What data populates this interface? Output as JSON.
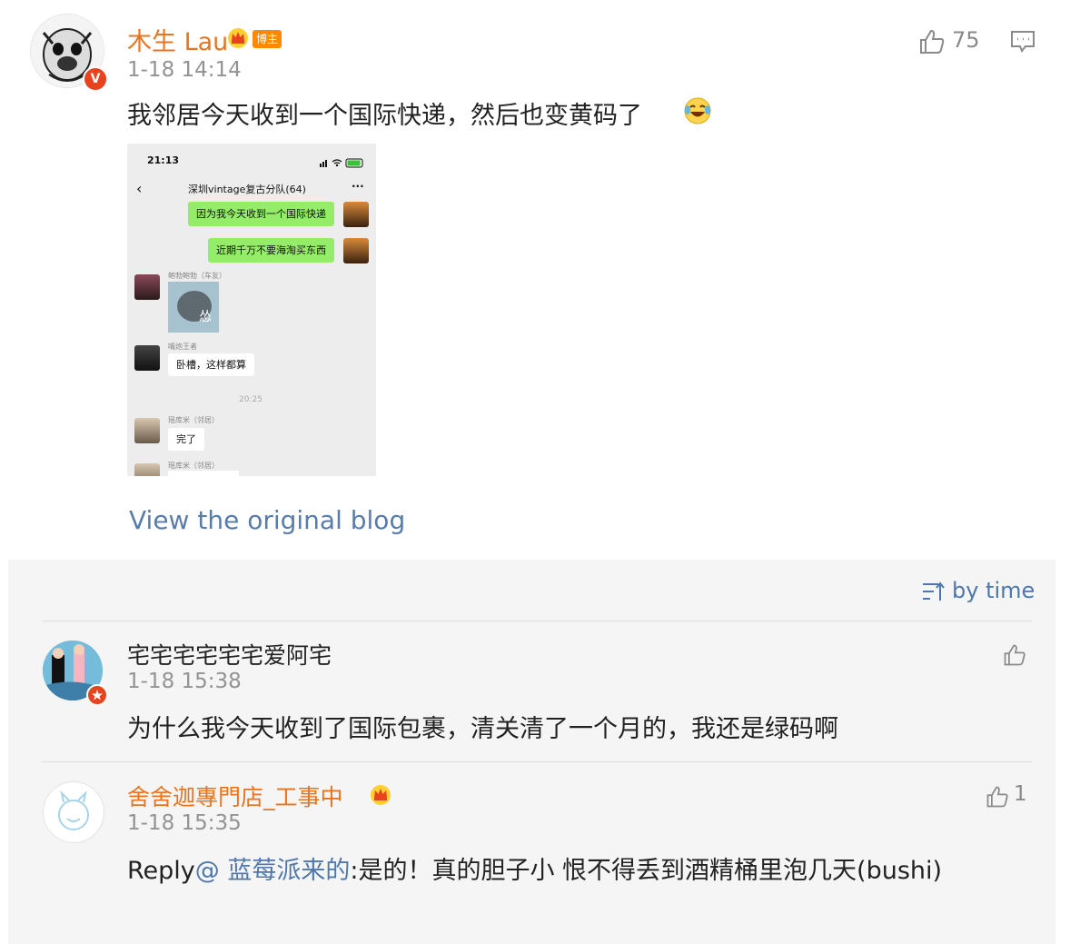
{
  "post": {
    "author": "木生 Lau",
    "host_badge": "博主",
    "verified_badge": "V",
    "time": "1-18 14:14",
    "text": "我邻居今天收到一个国际快递，然后也变黄码了",
    "like_count": "75",
    "view_original": "View the original blog"
  },
  "screenshot": {
    "status_time": "21:13",
    "chat_title": "深圳vintage复古分队(64)",
    "more": "···",
    "messages": [
      "因为我今天收到一个国际快递",
      "近期千万不要海淘买东西"
    ],
    "sender1": "鲍勃鲍勃（车友）",
    "sticker_char": "怂",
    "sender2": "嘴炮王者",
    "reply2": "卧槽，这样都算",
    "divider_time": "20:25",
    "sender3": "瑶库米（邻居）",
    "reply3": "完了",
    "sender4": "瑶库米（邻居）"
  },
  "comments_header": {
    "sort_label": "by time"
  },
  "comments": [
    {
      "name": "宅宅宅宅宅宅爱阿宅",
      "time": "1-18 15:38",
      "text": "为什么我今天收到了国际包裹，清关清了一个月的，我还是绿码啊"
    },
    {
      "name": "舍舍迦專門店_工事中",
      "time": "1-18 15:35",
      "like_count": "1",
      "reply_prefix": "Reply",
      "mention": "@ 蓝莓派来的",
      "text": ":是的！真的胆子小 恨不得丢到酒精桶里泡几天(bushi)"
    }
  ],
  "colors": {
    "orange_name": "#e8741f",
    "link_blue": "#5a7ca8",
    "sort_blue": "#4f77ab",
    "wechat_green": "#95ec69",
    "panel_bg": "#f5f5f5"
  }
}
